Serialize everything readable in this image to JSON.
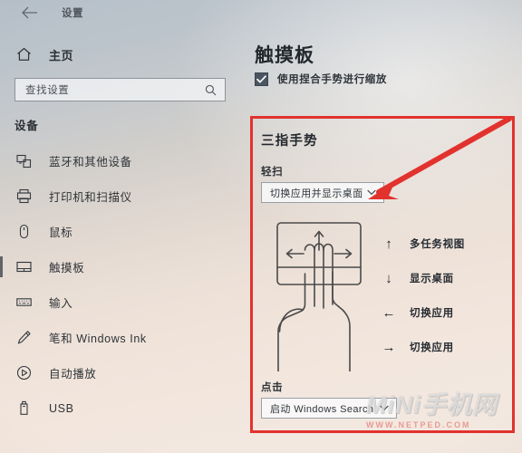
{
  "window": {
    "title": "设置",
    "back_icon": "back-arrow-icon"
  },
  "sidebar": {
    "home": {
      "label": "主页",
      "icon": "home-icon"
    },
    "search": {
      "placeholder": "查找设置",
      "icon": "search-icon"
    },
    "group_title": "设备",
    "items": [
      {
        "label": "蓝牙和其他设备",
        "icon": "bluetooth-device-icon",
        "selected": false
      },
      {
        "label": "打印机和扫描仪",
        "icon": "printer-icon",
        "selected": false
      },
      {
        "label": "鼠标",
        "icon": "mouse-icon",
        "selected": false
      },
      {
        "label": "触摸板",
        "icon": "touchpad-icon",
        "selected": true
      },
      {
        "label": "输入",
        "icon": "keyboard-icon",
        "selected": false
      },
      {
        "label": "笔和 Windows Ink",
        "icon": "pen-icon",
        "selected": false
      },
      {
        "label": "自动播放",
        "icon": "autoplay-icon",
        "selected": false
      },
      {
        "label": "USB",
        "icon": "usb-icon",
        "selected": false
      }
    ]
  },
  "main": {
    "page_title": "触摸板",
    "zoom_checkbox": {
      "label": "使用捏合手势进行缩放",
      "checked": true,
      "icon": "checkmark-icon"
    },
    "section": {
      "title": "三指手势",
      "swipe_label": "轻扫",
      "swipe_value": "切换应用并显示桌面",
      "swipe_caret_icon": "chevron-down-icon",
      "tap_label": "点击",
      "tap_value": "启动 Windows Search",
      "tap_caret_icon": "chevron-down-icon",
      "illustration_icon": "three-finger-touchpad-icon",
      "legend": [
        {
          "arrow": "↑",
          "arrow_icon": "arrow-up-icon",
          "label": "多任务视图"
        },
        {
          "arrow": "↓",
          "arrow_icon": "arrow-down-icon",
          "label": "显示桌面"
        },
        {
          "arrow": "←",
          "arrow_icon": "arrow-left-icon",
          "label": "切换应用"
        },
        {
          "arrow": "→",
          "arrow_icon": "arrow-right-icon",
          "label": "切换应用"
        }
      ]
    }
  },
  "annotation": {
    "highlight_color": "#e8302c",
    "arrow_icon": "red-pointer-arrow-icon"
  },
  "watermark": {
    "main": "MiNi手机网",
    "url": "WWW.NETPED.COM"
  },
  "colors": {
    "accent_red": "#e8302c",
    "checkbox_fill": "#4b5563",
    "text_primary": "#23282d",
    "text_secondary": "#2e3339"
  }
}
